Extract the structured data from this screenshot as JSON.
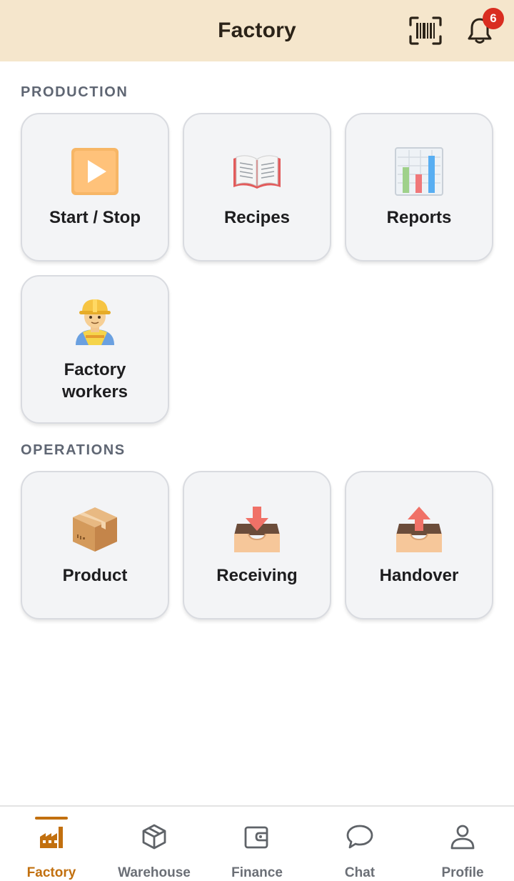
{
  "header": {
    "title": "Factory",
    "notification_count": "6"
  },
  "sections": {
    "production": {
      "title": "PRODUCTION",
      "tiles": [
        {
          "label": "Start / Stop",
          "icon": "play-button-icon"
        },
        {
          "label": "Recipes",
          "icon": "open-book-icon"
        },
        {
          "label": "Reports",
          "icon": "bar-chart-icon"
        },
        {
          "label_line1": "Factory",
          "label_line2": "workers",
          "icon": "construction-worker-icon"
        }
      ]
    },
    "operations": {
      "title": "OPERATIONS",
      "tiles": [
        {
          "label": "Product",
          "icon": "package-box-icon"
        },
        {
          "label": "Receiving",
          "icon": "inbox-tray-icon"
        },
        {
          "label": "Handover",
          "icon": "outbox-tray-icon"
        }
      ]
    }
  },
  "bottom_nav": {
    "items": [
      {
        "label": "Factory",
        "icon": "factory-icon",
        "active": true
      },
      {
        "label": "Warehouse",
        "icon": "cube-icon"
      },
      {
        "label": "Finance",
        "icon": "wallet-icon"
      },
      {
        "label": "Chat",
        "icon": "chat-bubble-icon"
      },
      {
        "label": "Profile",
        "icon": "user-icon"
      }
    ]
  },
  "colors": {
    "header_bg": "#f5e6cc",
    "accent": "#c2700f",
    "badge": "#d92d20",
    "tile_bg": "#f3f4f6",
    "section_title": "#5f6673"
  }
}
